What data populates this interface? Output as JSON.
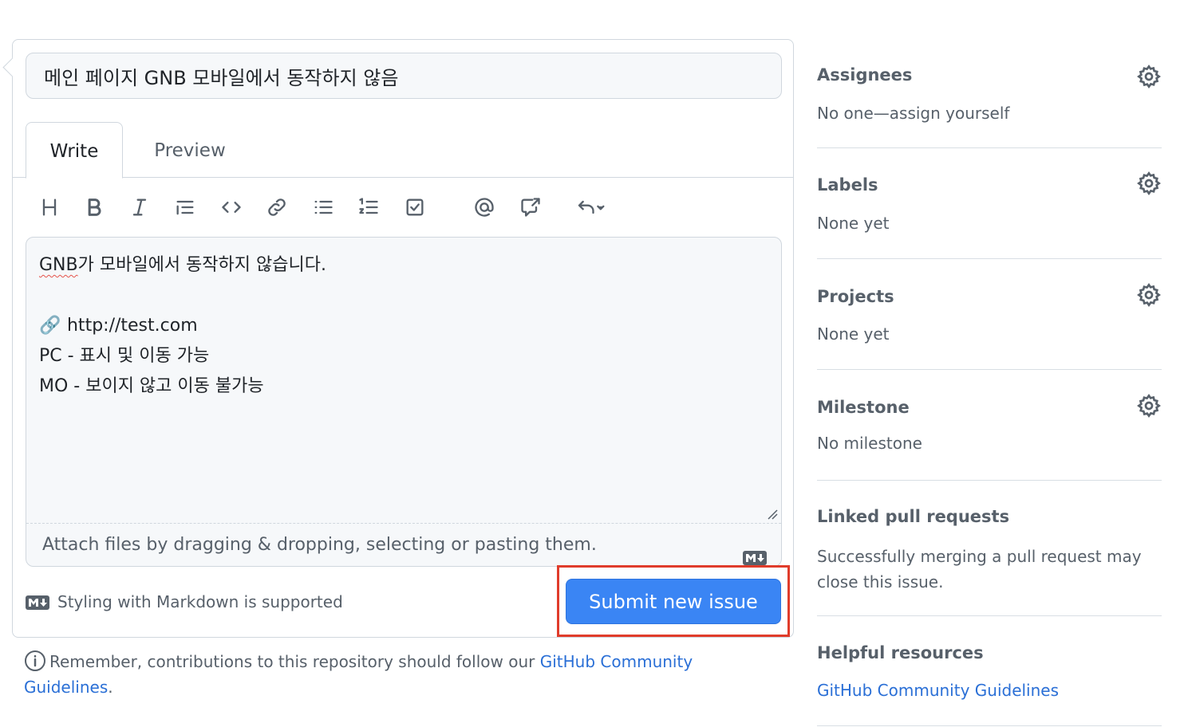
{
  "issue": {
    "title": "메인 페이지 GNB 모바일에서 동작하지 않음",
    "tabs": [
      {
        "label": "Write",
        "active": true
      },
      {
        "label": "Preview",
        "active": false
      }
    ],
    "toolbar": [
      {
        "name": "heading-icon"
      },
      {
        "name": "bold-icon"
      },
      {
        "name": "italic-icon"
      },
      {
        "name": "quote-icon"
      },
      {
        "name": "code-icon"
      },
      {
        "name": "link-icon"
      },
      {
        "name": "unordered-list-icon"
      },
      {
        "name": "ordered-list-icon"
      },
      {
        "name": "task-list-icon"
      },
      {
        "name": "mention-icon"
      },
      {
        "name": "cross-reference-icon"
      },
      {
        "name": "reply-icon"
      }
    ],
    "body": {
      "line1_spell": "GNB",
      "line1_rest": "가 모바일에서 동작하지 않습니다.",
      "line2": "",
      "line3_emoji": "🔗",
      "line3_text": " http://test.com",
      "line4": "PC - 표시 및 이동 가능",
      "line5": "MO - 보이지 않고 이동 불가능"
    },
    "attach_hint": "Attach files by dragging & dropping, selecting or pasting them.",
    "markdown_note": "Styling with Markdown is supported",
    "submit_label": "Submit new issue",
    "remember_prefix": "Remember, contributions to this repository should follow our ",
    "remember_link": "GitHub Community Guidelines",
    "remember_suffix": "."
  },
  "sidebar": {
    "assignees": {
      "heading": "Assignees",
      "value": "No one—assign yourself"
    },
    "labels": {
      "heading": "Labels",
      "value": "None yet"
    },
    "projects": {
      "heading": "Projects",
      "value": "None yet"
    },
    "milestone": {
      "heading": "Milestone",
      "value": "No milestone"
    },
    "linked_prs": {
      "heading": "Linked pull requests",
      "value": "Successfully merging a pull request may close this issue."
    },
    "helpful": {
      "heading": "Helpful resources",
      "link": "GitHub Community Guidelines"
    }
  },
  "colors": {
    "primary_button": "#3a85f4",
    "highlight_box": "#e03c2b",
    "link": "#2a6fd6"
  }
}
